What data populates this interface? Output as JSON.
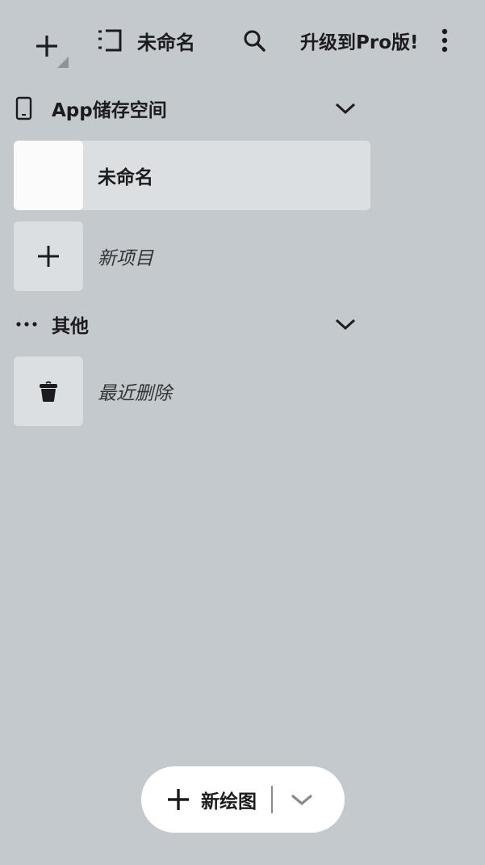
{
  "toolbar": {
    "add_icon": "plus-icon",
    "doc_title_icon": "outline-list-icon",
    "doc_title": "未命名",
    "search_icon": "search-icon",
    "upgrade_label": "升级到Pro版!",
    "more_icon": "more-vertical-icon"
  },
  "sections": {
    "app_storage": {
      "icon": "phone-icon",
      "label": "App储存空间",
      "chevron": "chevron-down-icon",
      "items": [
        {
          "name": "未命名",
          "selected": true
        }
      ],
      "new_item_label": "新项目"
    },
    "other": {
      "icon": "more-horizontal-icon",
      "label": "其他",
      "chevron": "chevron-down-icon",
      "items": [
        {
          "name": "最近删除",
          "icon": "trash-icon"
        }
      ]
    }
  },
  "fab": {
    "icon": "plus-icon",
    "label": "新绘图",
    "dropdown_icon": "chevron-down-icon"
  },
  "colors": {
    "background": "#c4c9cd",
    "tile": "#dcdfe1",
    "fab_background": "#ffffff",
    "text": "#1c1c1e"
  }
}
